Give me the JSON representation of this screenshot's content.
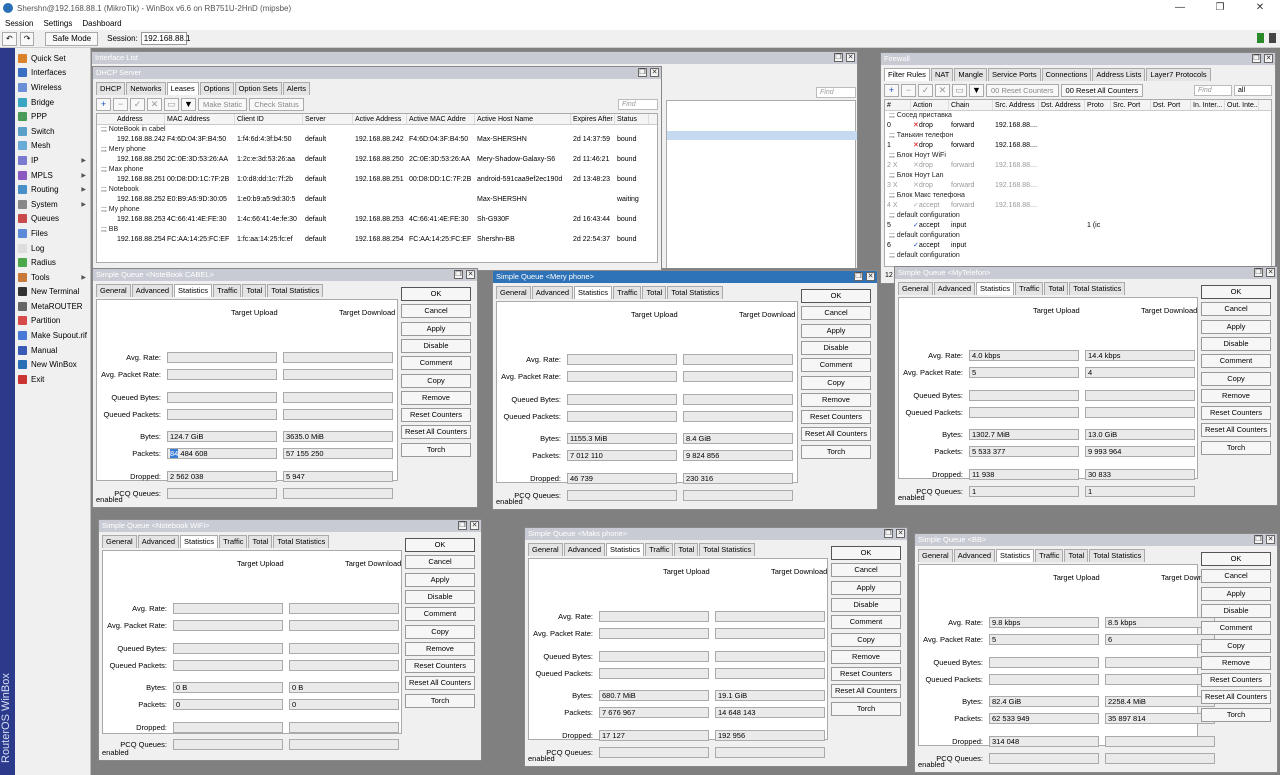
{
  "window": {
    "title": "Shershn@192.168.88.1 (MikroTik) - WinBox v6.6 on RB751U-2HnD (mipsbe)",
    "min": "—",
    "max": "❐",
    "close": "✕"
  },
  "menu": [
    "Session",
    "Settings",
    "Dashboard"
  ],
  "toolbar": {
    "undo": "↶",
    "redo": "↷",
    "safe_mode": "Safe Mode",
    "session_label": "Session:",
    "session_value": "192.168.88.1"
  },
  "brand": "RouterOS WinBox",
  "sidebar": [
    {
      "label": "Quick Set",
      "color": "#d9822b",
      "arrow": false
    },
    {
      "label": "Interfaces",
      "color": "#3a6fc4",
      "arrow": false
    },
    {
      "label": "Wireless",
      "color": "#6b8fd6",
      "arrow": false
    },
    {
      "label": "Bridge",
      "color": "#3aa6c4",
      "arrow": false
    },
    {
      "label": "PPP",
      "color": "#4a9a5a",
      "arrow": false
    },
    {
      "label": "Switch",
      "color": "#5aa0c8",
      "arrow": false
    },
    {
      "label": "Mesh",
      "color": "#6aaad8",
      "arrow": false
    },
    {
      "label": "IP",
      "color": "#7a7ad0",
      "arrow": true
    },
    {
      "label": "MPLS",
      "color": "#8a5ac0",
      "arrow": true
    },
    {
      "label": "Routing",
      "color": "#4a90c8",
      "arrow": true
    },
    {
      "label": "System",
      "color": "#888888",
      "arrow": true
    },
    {
      "label": "Queues",
      "color": "#c84a4a",
      "arrow": false
    },
    {
      "label": "Files",
      "color": "#5a8ad8",
      "arrow": false
    },
    {
      "label": "Log",
      "color": "#dddddd",
      "arrow": false
    },
    {
      "label": "Radius",
      "color": "#4aa84a",
      "arrow": false
    },
    {
      "label": "Tools",
      "color": "#c87a3a",
      "arrow": true
    },
    {
      "label": "New Terminal",
      "color": "#333333",
      "arrow": false
    },
    {
      "label": "MetaROUTER",
      "color": "#666666",
      "arrow": false
    },
    {
      "label": "Partition",
      "color": "#d84a4a",
      "arrow": false
    },
    {
      "label": "Make Supout.rif",
      "color": "#4a7ad8",
      "arrow": false
    },
    {
      "label": "Manual",
      "color": "#3a5ab8",
      "arrow": false
    },
    {
      "label": "New WinBox",
      "color": "#2a6fb5",
      "arrow": false
    },
    {
      "label": "Exit",
      "color": "#cc3333",
      "arrow": false
    }
  ],
  "interface_list": {
    "title": "Interface List",
    "find": "Find"
  },
  "dhcp": {
    "title": "DHCP Server",
    "tabs": [
      "DHCP",
      "Networks",
      "Leases",
      "Options",
      "Option Sets",
      "Alerts"
    ],
    "buttons": {
      "add": "+",
      "remove": "−",
      "make_static": "Make Static",
      "check_status": "Check Status",
      "find": "Find"
    },
    "columns": [
      "Address",
      "MAC Address",
      "Client ID",
      "Server",
      "Active Address",
      "Active MAC Addre",
      "Active Host Name",
      "Expires After",
      "Status"
    ],
    "rows": [
      {
        "comment": ";;; NoteBook in cabel",
        "cells": [
          "192.168.88.242",
          "F4:6D:04:3F:B4:50",
          "1:f4:6d:4:3f:b4:50",
          "default",
          "192.168.88.242",
          "F4:6D:04:3F:B4:50",
          "Max-SHERSHN",
          "2d 14:37:59",
          "bound"
        ]
      },
      {
        "comment": ";;; Mery phone",
        "cells": [
          "192.168.88.250",
          "2C:0E:3D:53:26:AA",
          "1:2c:e:3d:53:26:aa",
          "default",
          "192.168.88.250",
          "2C:0E:3D:53:26:AA",
          "Mery-Shadow-Galaxy-S6",
          "2d 11:46:21",
          "bound"
        ]
      },
      {
        "comment": ";;; Max phone",
        "cells": [
          "192.168.88.251",
          "00:D8:DD:1C:7F:2B",
          "1:0:d8:dd:1c:7f:2b",
          "default",
          "192.168.88.251",
          "00:D8:DD:1C:7F:2B",
          "android-591caa9ef2ec190d",
          "2d 13:48:23",
          "bound"
        ]
      },
      {
        "comment": ";;; Notebook",
        "cells": [
          "192.168.88.252",
          "E0:B9:A5:9D:30:05",
          "1:e0:b9:a5:9d:30:5",
          "default",
          "",
          "",
          "Max-SHERSHN",
          "",
          "waiting"
        ]
      },
      {
        "comment": ";;; My phone",
        "cells": [
          "192.168.88.253",
          "4C:66:41:4E:FE:30",
          "1:4c:66:41:4e:fe:30",
          "default",
          "192.168.88.253",
          "4C:66:41:4E:FE:30",
          "Sh-G930F",
          "2d 16:43:44",
          "bound"
        ]
      },
      {
        "comment": ";;; BB",
        "cells": [
          "192.168.88.254",
          "FC:AA:14:25:FC:EF",
          "1:fc:aa:14:25:fc:ef",
          "default",
          "192.168.88.254",
          "FC:AA:14:25:FC:EF",
          "Shershn-BB",
          "2d 22:54:37",
          "bound"
        ]
      }
    ]
  },
  "firewall": {
    "title": "Firewall",
    "tabs": [
      "Filter Rules",
      "NAT",
      "Mangle",
      "Service Ports",
      "Connections",
      "Address Lists",
      "Layer7 Protocols"
    ],
    "buttons": {
      "reset_counters": "Reset Counters",
      "reset_all_counters": "Reset All Counters",
      "find": "Find",
      "all": "all",
      "oo": "00"
    },
    "columns": [
      "#",
      "Action",
      "Chain",
      "Src. Address",
      "Dst. Address",
      "Proto",
      "Src. Port",
      "Dst. Port",
      "In. Inter...",
      "Out. Inte..."
    ],
    "rows": [
      {
        "comment": ";;; Сосед приставка",
        "num": "0",
        "flag": "",
        "action": "drop",
        "chain": "forward",
        "src": "192.168.88....",
        "proto": "",
        "disabled": false,
        "accept": false
      },
      {
        "comment": ";;; Танькин телефон",
        "num": "1",
        "flag": "",
        "action": "drop",
        "chain": "forward",
        "src": "192.168.88....",
        "proto": "",
        "disabled": false,
        "accept": false
      },
      {
        "comment": ";;; Блок Ноут WiFi",
        "num": "2",
        "flag": "X",
        "action": "drop",
        "chain": "forward",
        "src": "192.168.88....",
        "proto": "",
        "disabled": true,
        "accept": false
      },
      {
        "comment": ";;; Блок Ноут Lan",
        "num": "3",
        "flag": "X",
        "action": "drop",
        "chain": "forward",
        "src": "192.168.88....",
        "proto": "",
        "disabled": true,
        "accept": false
      },
      {
        "comment": ";;; Блок Макс телефона",
        "num": "4",
        "flag": "X",
        "action": "accept",
        "chain": "forward",
        "src": "192.168.88....",
        "proto": "",
        "disabled": true,
        "accept": true
      },
      {
        "comment": ";;; default configuration",
        "num": "5",
        "flag": "",
        "action": "accept",
        "chain": "input",
        "src": "",
        "proto": "1 (ic",
        "disabled": false,
        "accept": true
      },
      {
        "comment": ";;; default configuration",
        "num": "6",
        "flag": "",
        "action": "accept",
        "chain": "input",
        "src": "",
        "proto": "",
        "disabled": false,
        "accept": true
      },
      {
        "comment": ";;; default configuration",
        "num": "",
        "flag": "",
        "action": "",
        "chain": "",
        "src": "",
        "proto": "",
        "disabled": false,
        "accept": false
      }
    ],
    "count": "12"
  },
  "queue_labels": {
    "tabs": [
      "General",
      "Advanced",
      "Statistics",
      "Traffic",
      "Total",
      "Total Statistics"
    ],
    "target_upload": "Target Upload",
    "target_download": "Target Download",
    "avg_rate": "Avg. Rate:",
    "avg_packet_rate": "Avg. Packet Rate:",
    "queued_bytes": "Queued Bytes:",
    "queued_packets": "Queued Packets:",
    "bytes": "Bytes:",
    "packets": "Packets:",
    "dropped": "Dropped:",
    "pcq_queues": "PCQ Queues:",
    "buttons": [
      "OK",
      "Cancel",
      "Apply",
      "Disable",
      "Comment",
      "Copy",
      "Remove",
      "Reset Counters",
      "Reset All Counters",
      "Torch"
    ],
    "status": "enabled"
  },
  "queues": [
    {
      "title": "Simple Queue <NoteBook CABEL>",
      "avg_rate": [
        "",
        ""
      ],
      "avg_packet_rate": [
        "",
        ""
      ],
      "queued_bytes": [
        "",
        ""
      ],
      "queued_packets": [
        "",
        ""
      ],
      "bytes": [
        "124.7 GiB",
        "3635.0 MiB"
      ],
      "packets": [
        "84 484 608",
        "57 155 250"
      ],
      "dropped": [
        "2 562 038",
        "5 947"
      ],
      "pcq_queues": [
        "",
        ""
      ],
      "active": false,
      "highlight": "84"
    },
    {
      "title": "Simple Queue <Mery phone>",
      "avg_rate": [
        "",
        ""
      ],
      "avg_packet_rate": [
        "",
        ""
      ],
      "queued_bytes": [
        "",
        ""
      ],
      "queued_packets": [
        "",
        ""
      ],
      "bytes": [
        "1155.3 MiB",
        "8.4 GiB"
      ],
      "packets": [
        "7 012 110",
        "9 824 856"
      ],
      "dropped": [
        "46 739",
        "230 316"
      ],
      "pcq_queues": [
        "",
        ""
      ],
      "active": true
    },
    {
      "title": "Simple Queue <MyTelefon>",
      "avg_rate": [
        "4.0 kbps",
        "14.4 kbps"
      ],
      "avg_packet_rate": [
        "5",
        "4"
      ],
      "queued_bytes": [
        "",
        ""
      ],
      "queued_packets": [
        "",
        ""
      ],
      "bytes": [
        "1302.7 MiB",
        "13.0 GiB"
      ],
      "packets": [
        "5 533 377",
        "9 993 964"
      ],
      "dropped": [
        "11 938",
        "30 833"
      ],
      "pcq_queues": [
        "1",
        "1"
      ],
      "active": false
    },
    {
      "title": "Simple Queue <Notebook WiFi>",
      "avg_rate": [
        "",
        ""
      ],
      "avg_packet_rate": [
        "",
        ""
      ],
      "queued_bytes": [
        "",
        ""
      ],
      "queued_packets": [
        "",
        ""
      ],
      "bytes": [
        "0 B",
        "0 B"
      ],
      "packets": [
        "0",
        "0"
      ],
      "dropped": [
        "",
        ""
      ],
      "pcq_queues": [
        "",
        ""
      ],
      "active": false
    },
    {
      "title": "Simple Queue <Maks phone>",
      "avg_rate": [
        "",
        ""
      ],
      "avg_packet_rate": [
        "",
        ""
      ],
      "queued_bytes": [
        "",
        ""
      ],
      "queued_packets": [
        "",
        ""
      ],
      "bytes": [
        "680.7 MiB",
        "19.1 GiB"
      ],
      "packets": [
        "7 676 967",
        "14 648 143"
      ],
      "dropped": [
        "17 127",
        "192 956"
      ],
      "pcq_queues": [
        "",
        ""
      ],
      "active": false
    },
    {
      "title": "Simple Queue <BB>",
      "avg_rate": [
        "9.8 kbps",
        "8.5 kbps"
      ],
      "avg_packet_rate": [
        "5",
        "6"
      ],
      "queued_bytes": [
        "",
        ""
      ],
      "queued_packets": [
        "",
        ""
      ],
      "bytes": [
        "82.4 GiB",
        "2258.4 MiB"
      ],
      "packets": [
        "62 533 949",
        "35 897 814"
      ],
      "dropped": [
        "314 048",
        ""
      ],
      "pcq_queues": [
        "",
        ""
      ],
      "active": false
    }
  ]
}
